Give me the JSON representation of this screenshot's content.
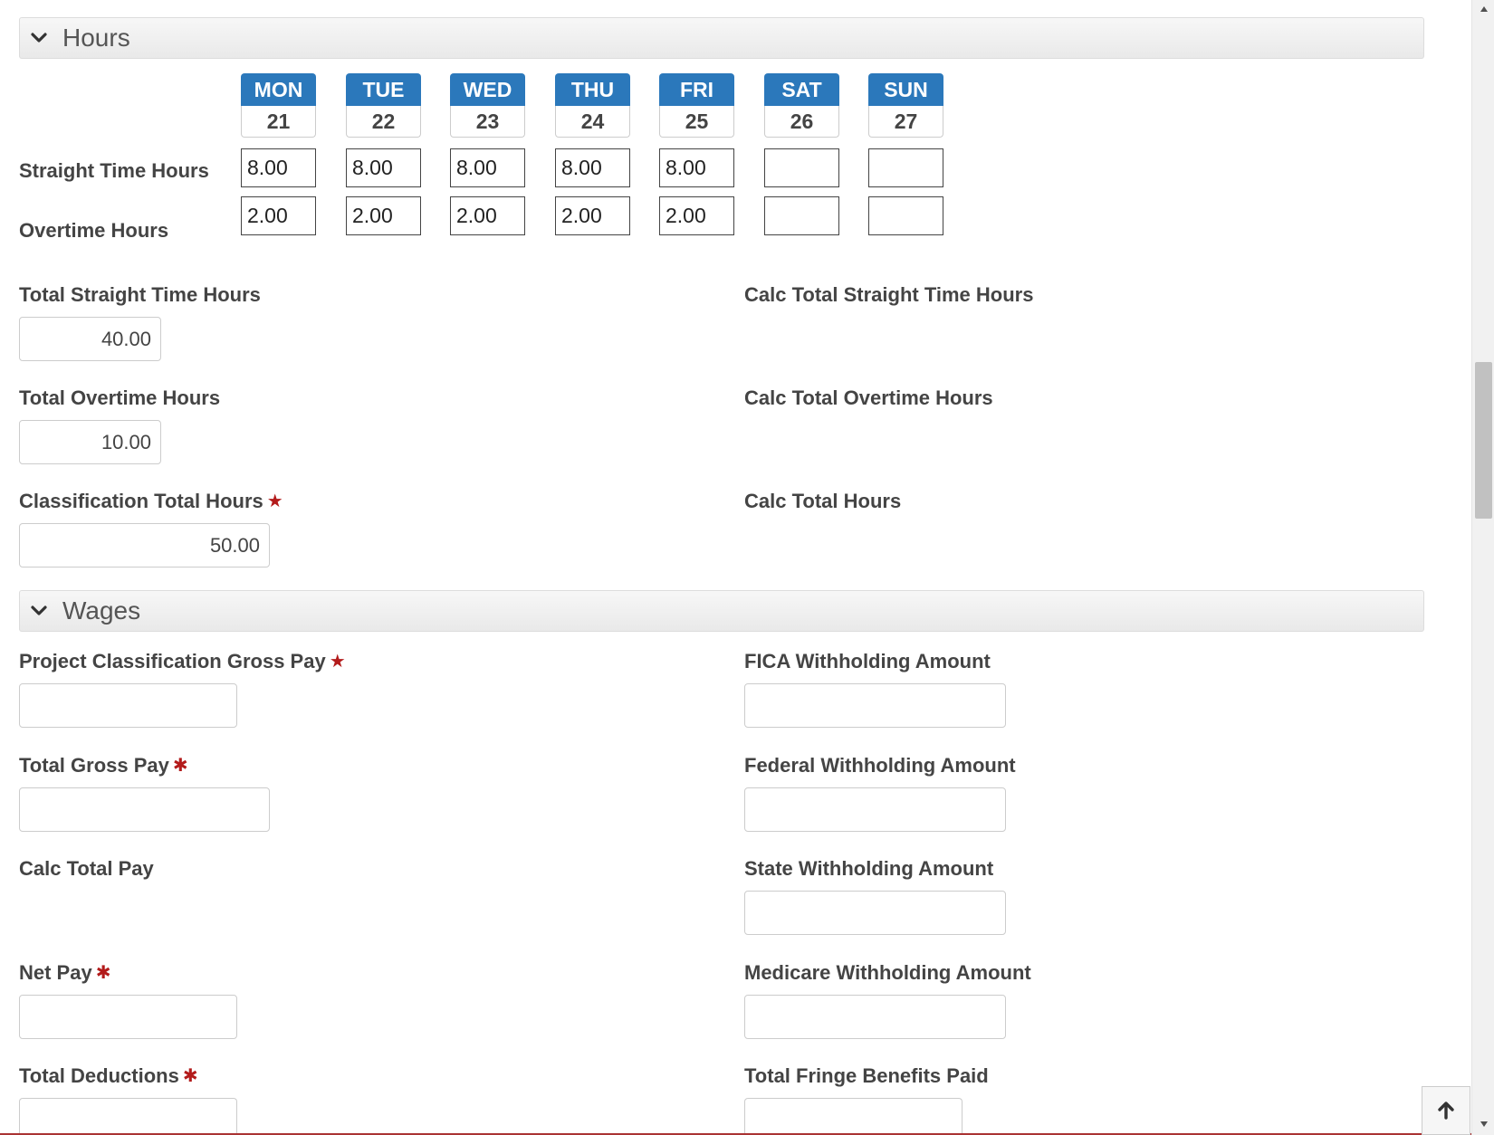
{
  "sections": {
    "hours": {
      "title": "Hours"
    },
    "wages": {
      "title": "Wages"
    }
  },
  "days": [
    {
      "name": "MON",
      "date": "21",
      "straight": "8.00",
      "overtime": "2.00"
    },
    {
      "name": "TUE",
      "date": "22",
      "straight": "8.00",
      "overtime": "2.00"
    },
    {
      "name": "WED",
      "date": "23",
      "straight": "8.00",
      "overtime": "2.00"
    },
    {
      "name": "THU",
      "date": "24",
      "straight": "8.00",
      "overtime": "2.00"
    },
    {
      "name": "FRI",
      "date": "25",
      "straight": "8.00",
      "overtime": "2.00"
    },
    {
      "name": "SAT",
      "date": "26",
      "straight": "",
      "overtime": ""
    },
    {
      "name": "SUN",
      "date": "27",
      "straight": "",
      "overtime": ""
    }
  ],
  "rows": {
    "straight_label": "Straight Time Hours",
    "overtime_label": "Overtime Hours"
  },
  "hours_fields": {
    "total_straight_label": "Total Straight Time Hours",
    "total_straight_value": "40.00",
    "calc_total_straight_label": "Calc Total Straight Time Hours",
    "total_overtime_label": "Total Overtime Hours",
    "total_overtime_value": "10.00",
    "calc_total_overtime_label": "Calc Total Overtime Hours",
    "classification_total_label": "Classification Total Hours",
    "classification_total_value": "50.00",
    "calc_total_hours_label": "Calc Total Hours"
  },
  "wages_fields": {
    "project_gross_label": "Project Classification Gross Pay",
    "fica_label": "FICA Withholding Amount",
    "total_gross_label": "Total Gross Pay",
    "federal_label": "Federal Withholding Amount",
    "calc_total_pay_label": "Calc Total Pay",
    "state_label": "State Withholding Amount",
    "net_pay_label": "Net Pay",
    "medicare_label": "Medicare Withholding Amount",
    "total_deductions_label": "Total Deductions",
    "fringe_label": "Total Fringe Benefits Paid"
  },
  "icons": {
    "section_toggle": "chevron-down-icon",
    "to_top": "arrow-up-icon"
  },
  "colors": {
    "day_header": "#2b78bb",
    "required": "#b31b1b"
  }
}
